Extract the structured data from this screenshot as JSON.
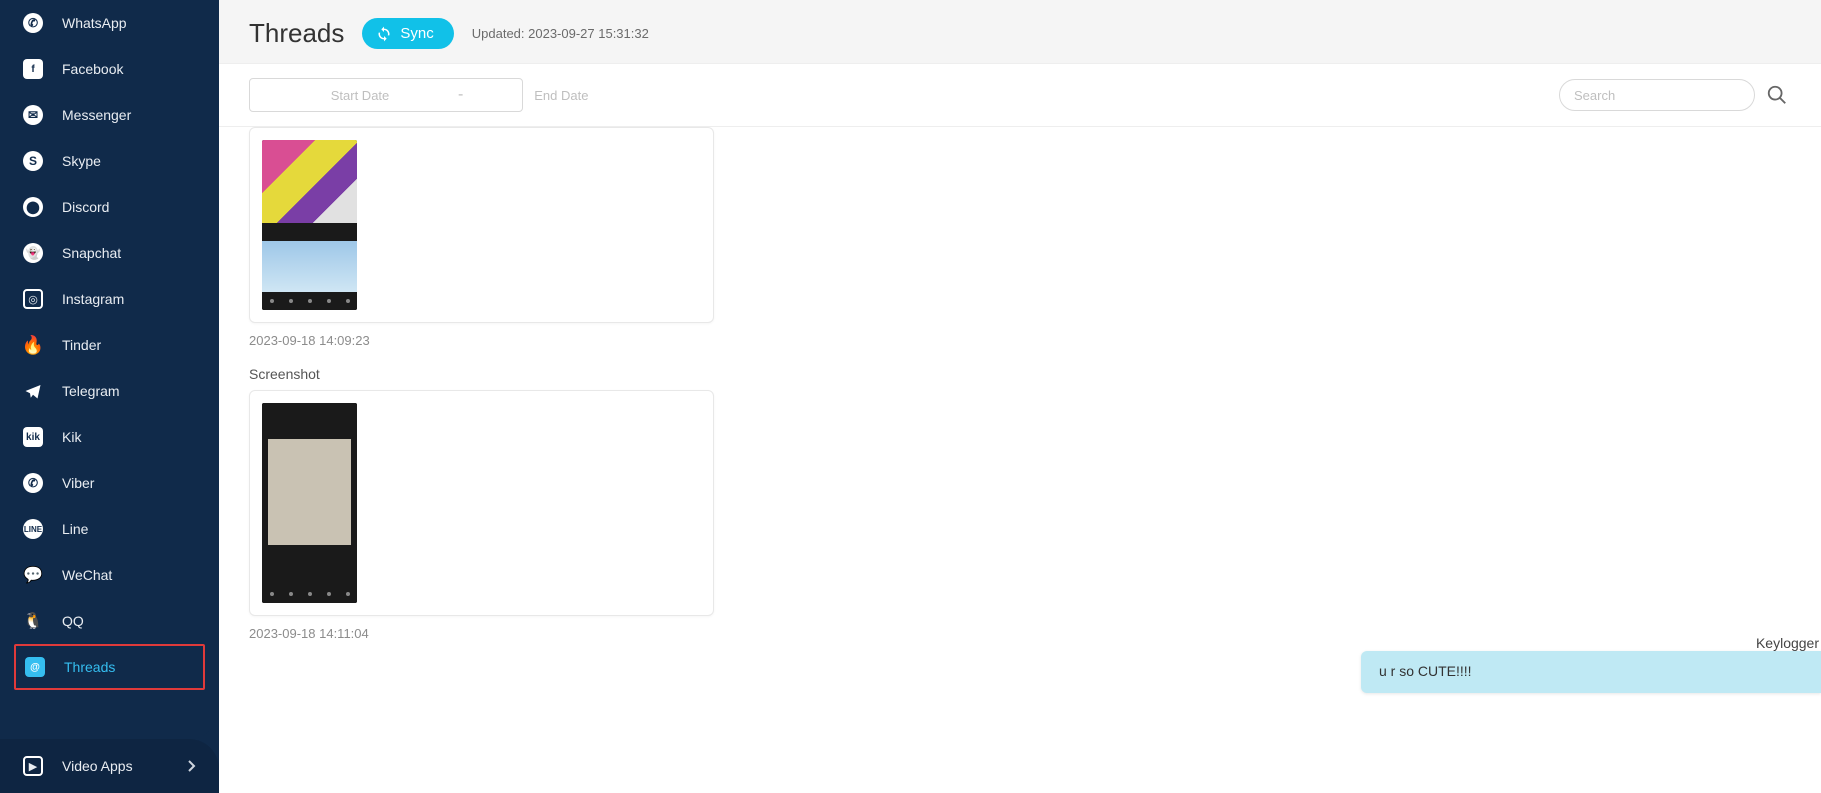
{
  "sidebar": {
    "items": [
      {
        "id": "whatsapp",
        "label": "WhatsApp"
      },
      {
        "id": "facebook",
        "label": "Facebook"
      },
      {
        "id": "messenger",
        "label": "Messenger"
      },
      {
        "id": "skype",
        "label": "Skype"
      },
      {
        "id": "discord",
        "label": "Discord"
      },
      {
        "id": "snapchat",
        "label": "Snapchat"
      },
      {
        "id": "instagram",
        "label": "Instagram"
      },
      {
        "id": "tinder",
        "label": "Tinder"
      },
      {
        "id": "telegram",
        "label": "Telegram"
      },
      {
        "id": "kik",
        "label": "Kik"
      },
      {
        "id": "viber",
        "label": "Viber"
      },
      {
        "id": "line",
        "label": "Line"
      },
      {
        "id": "wechat",
        "label": "WeChat"
      },
      {
        "id": "qq",
        "label": "QQ"
      },
      {
        "id": "threads",
        "label": "Threads"
      }
    ],
    "bottom": {
      "label": "Video Apps"
    }
  },
  "page": {
    "title": "Threads",
    "sync_label": "Sync",
    "updated": "Updated: 2023-09-27 15:31:32"
  },
  "filters": {
    "start_placeholder": "Start Date",
    "end_placeholder": "End Date",
    "separator": "-"
  },
  "search": {
    "placeholder": "Search"
  },
  "entries": [
    {
      "label": "",
      "timestamp": "2023-09-18 14:09:23"
    },
    {
      "label": "Screenshot",
      "timestamp": "2023-09-18 14:11:04"
    }
  ],
  "float": {
    "keylogger_label": "Keylogger",
    "chat_text": "u r so CUTE!!!!"
  }
}
